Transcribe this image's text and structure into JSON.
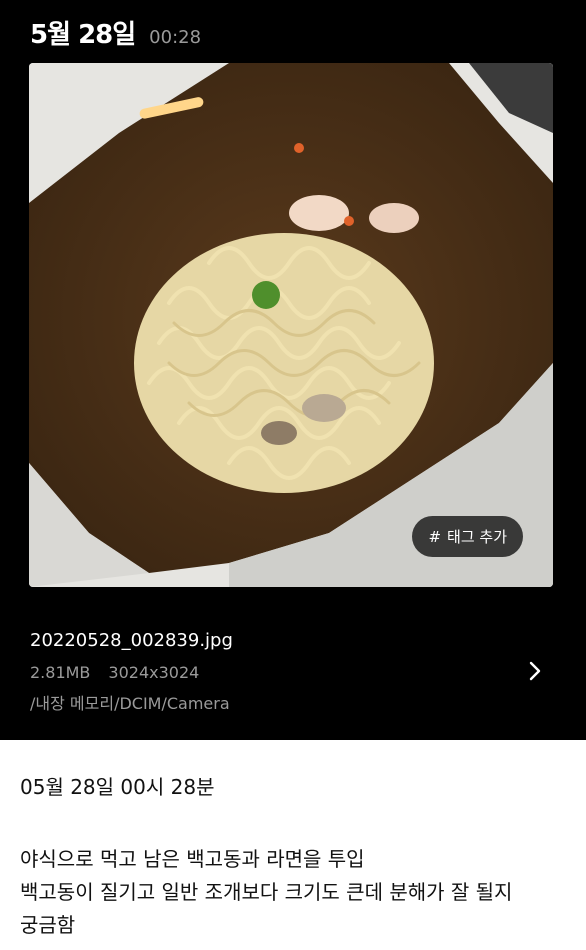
{
  "header": {
    "date": "5월 28일",
    "time": "00:28"
  },
  "photo": {
    "tag_label": "태그 추가",
    "tag_icon": "hash-icon"
  },
  "file": {
    "name": "20220528_002839.jpg",
    "size": "2.81MB",
    "resolution": "3024x3024",
    "path": "/내장 메모리/DCIM/Camera"
  },
  "detail": {
    "timestamp": "05월 28일 00시 28분",
    "lines": [
      "야식으로 먹고 남은 백고동과 라면을 투입",
      "백고동이 질기고 일반 조개보다 크기도 큰데 분해가 잘 될지",
      "궁금함"
    ]
  },
  "colors": {
    "background": "#000000",
    "text_primary": "#ffffff",
    "text_secondary": "#9a9a9a",
    "panel": "#ffffff"
  }
}
